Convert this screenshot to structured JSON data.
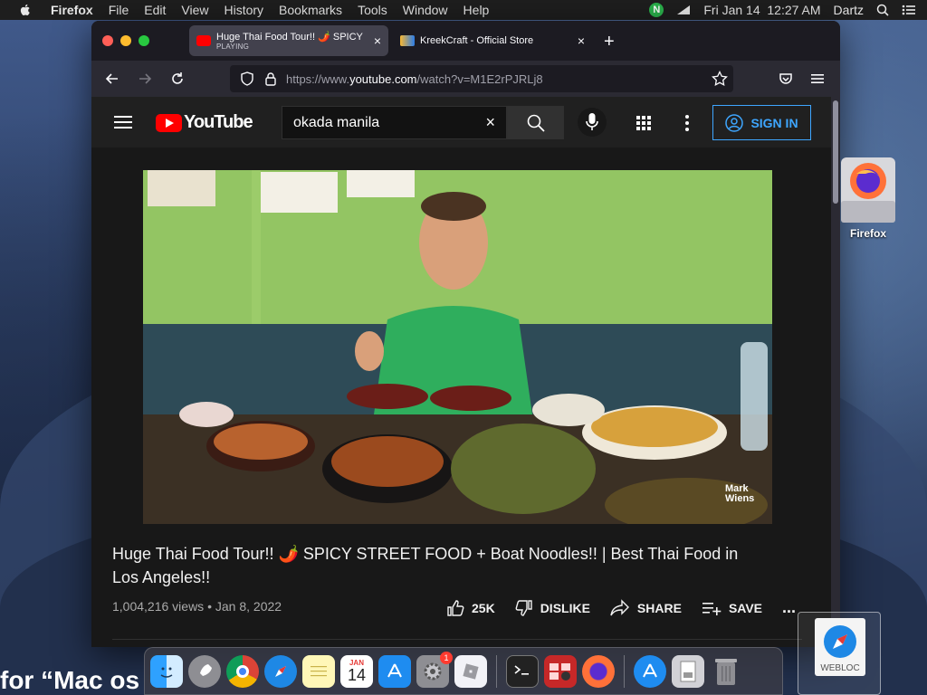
{
  "menubar": {
    "app_name": "Firefox",
    "items": [
      "File",
      "Edit",
      "View",
      "History",
      "Bookmarks",
      "Tools",
      "Window",
      "Help"
    ],
    "status_badge": "N",
    "clock": "Fri Jan 14  12:27 AM",
    "user": "Dartz"
  },
  "browser": {
    "tabs": [
      {
        "title": "Huge Thai Food Tour!! 🌶️ SPICY",
        "subtitle": "PLAYING",
        "close": "×"
      },
      {
        "title": "KreekCraft - Official Store",
        "close": "×"
      }
    ],
    "new_tab": "+",
    "url_prefix": "https://www.",
    "url_domain": "youtube.com",
    "url_path": "/watch?v=M1E2rPJRLj8"
  },
  "youtube": {
    "logo_text": "YouTube",
    "search_value": "okada manila",
    "search_clear": "×",
    "sign_in": "SIGN IN",
    "video_watermark": "Mark\nWiens",
    "video_title": "Huge Thai Food Tour!! 🌶️ SPICY STREET FOOD + Boat Noodles!! | Best Thai Food in Los Angeles!!",
    "views": "1,004,216 views",
    "date": "Jan 8, 2022",
    "likes": "25K",
    "dislike": "DISLIKE",
    "share": "SHARE",
    "save": "SAVE",
    "more": "..."
  },
  "desktop": {
    "firefox_label": "Firefox",
    "webloc_label": "WEBLOC",
    "partial_text": "for “Mac os"
  },
  "dock": {
    "calendar_month": "JAN",
    "calendar_day": "14",
    "settings_badge": "1"
  },
  "colors": {
    "yt_red": "#ff0000",
    "signin_blue": "#3ea6ff",
    "traffic_red": "#ff5f57",
    "traffic_yellow": "#febc2e",
    "traffic_green": "#28c840"
  }
}
